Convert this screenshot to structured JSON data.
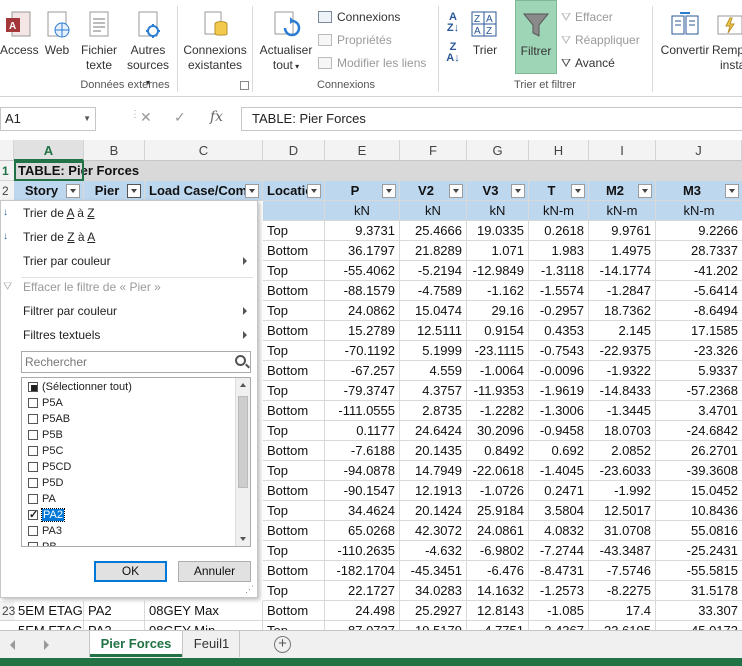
{
  "ribbon": {
    "buttons": {
      "access": "Access",
      "web": "Web",
      "text_file": "Fichier texte",
      "text_file_l1": "Fichier",
      "text_file_l2": "texte",
      "other_sources_l1": "Autres",
      "other_sources_l2": "sources",
      "existing_conn_l1": "Connexions",
      "existing_conn_l2": "existantes",
      "refresh_l1": "Actualiser",
      "refresh_l2": "tout",
      "connections": "Connexions",
      "properties": "Propriétés",
      "edit_links": "Modifier les liens",
      "sort": "Trier",
      "filter": "Filtrer",
      "clear": "Effacer",
      "reapply": "Réappliquer",
      "advanced": "Avancé",
      "convert": "Convertir",
      "remp_l1": "Remp",
      "remp_l2": "insta"
    },
    "groups": {
      "external_data": "Données externes",
      "connections": "Connexions",
      "sort_filter": "Trier et filtrer"
    }
  },
  "formula_bar": {
    "name_box": "A1",
    "fx": "fx",
    "content": "TABLE:  Pier Forces"
  },
  "grid": {
    "columns": [
      "A",
      "B",
      "C",
      "D",
      "E",
      "F",
      "G",
      "H",
      "I",
      "J"
    ],
    "row_numbers": {
      "r1": "1",
      "r2": "2",
      "r23": "23"
    },
    "title": "TABLE:  Pier Forces",
    "headers": [
      "Story",
      "Pier",
      "Load Case/Combo",
      "Location",
      "P",
      "V2",
      "V3",
      "T",
      "M2",
      "M3"
    ],
    "header_display": [
      "Story",
      "Pier",
      "Load Case/Coml",
      "Locatio",
      "P",
      "V2",
      "V3",
      "T",
      "M2",
      "M3"
    ],
    "units": [
      "kN",
      "kN",
      "kN",
      "kN-m",
      "kN-m",
      "kN-m"
    ],
    "rows": [
      [
        "Top",
        "9.3731",
        "25.4666",
        "19.0335",
        "0.2618",
        "9.9761",
        "9.2266"
      ],
      [
        "Bottom",
        "36.1797",
        "21.8289",
        "1.071",
        "1.983",
        "1.4975",
        "28.7337"
      ],
      [
        "Top",
        "-55.4062",
        "-5.2194",
        "-12.9849",
        "-1.3118",
        "-14.1774",
        "-41.202"
      ],
      [
        "Bottom",
        "-88.1579",
        "-4.7589",
        "-1.162",
        "-1.5574",
        "-1.2847",
        "-5.6414"
      ],
      [
        "Top",
        "24.0862",
        "15.0474",
        "29.16",
        "-0.2957",
        "18.7362",
        "-8.6494"
      ],
      [
        "Bottom",
        "15.2789",
        "12.5111",
        "0.9154",
        "0.4353",
        "2.145",
        "17.1585"
      ],
      [
        "Top",
        "-70.1192",
        "5.1999",
        "-23.1115",
        "-0.7543",
        "-22.9375",
        "-23.326"
      ],
      [
        "Bottom",
        "-67.257",
        "4.559",
        "-1.0064",
        "-0.0096",
        "-1.9322",
        "5.9337"
      ],
      [
        "Top",
        "-79.3747",
        "4.3757",
        "-11.9353",
        "-1.9619",
        "-14.8433",
        "-57.2368"
      ],
      [
        "Bottom",
        "-111.0555",
        "2.8735",
        "-1.2282",
        "-1.3006",
        "-1.3445",
        "3.4701"
      ],
      [
        "Top",
        "0.1177",
        "24.6424",
        "30.2096",
        "-0.9458",
        "18.0703",
        "-24.6842"
      ],
      [
        "Bottom",
        "-7.6188",
        "20.1435",
        "0.8492",
        "0.692",
        "2.0852",
        "26.2701"
      ],
      [
        "Top",
        "-94.0878",
        "14.7949",
        "-22.0618",
        "-1.4045",
        "-23.6033",
        "-39.3608"
      ],
      [
        "Bottom",
        "-90.1547",
        "12.1913",
        "-1.0726",
        "0.2471",
        "-1.992",
        "15.0452"
      ],
      [
        "Top",
        "34.4624",
        "20.1424",
        "25.9184",
        "3.5804",
        "12.5017",
        "10.8436"
      ],
      [
        "Bottom",
        "65.0268",
        "42.3072",
        "24.0861",
        "4.0832",
        "31.0708",
        "55.0816"
      ],
      [
        "Top",
        "-110.2635",
        "-4.632",
        "-6.9802",
        "-7.2744",
        "-43.3487",
        "-25.2431"
      ],
      [
        "Bottom",
        "-182.1704",
        "-45.3451",
        "-6.476",
        "-8.4731",
        "-7.5746",
        "-55.5815"
      ],
      [
        "Top",
        "22.1727",
        "34.0283",
        "14.1632",
        "-1.2573",
        "-8.2275",
        "31.5178"
      ]
    ],
    "row23": [
      "5EM ETAG",
      "PA2",
      "08GEY Max",
      "Bottom",
      "24.498",
      "25.2927",
      "12.8143",
      "-1.085",
      "17.4",
      "33.307"
    ],
    "row24_partial": [
      "5EM ETAG",
      "PA2",
      "08GEY Min",
      "Top",
      "-87.0737",
      "19.5179",
      "-4.7751",
      "-2.4367",
      "-23.6195",
      "-45.0173"
    ]
  },
  "filter_menu": {
    "sort_az_pre": "Trier de ",
    "sort_az_u1": "A",
    "sort_az_mid": " à ",
    "sort_az_u2": "Z",
    "sort_za_pre": "Trier de ",
    "sort_za_u1": "Z",
    "sort_za_mid": " à ",
    "sort_za_u2": "A",
    "sort_color": "Trier par couleur",
    "clear_filter": "Effacer le filtre de « Pier »",
    "filter_color": "Filtrer par couleur",
    "text_filters": "Filtres textuels",
    "search_placeholder": "Rechercher",
    "items": [
      "(Sélectionner tout)",
      "P5A",
      "P5AB",
      "P5B",
      "P5C",
      "P5CD",
      "P5D",
      "PA",
      "PA2",
      "PA3",
      "PB"
    ],
    "ok": "OK",
    "cancel": "Annuler"
  },
  "sheets": {
    "tabs": [
      "Pier Forces",
      "Feuil1"
    ],
    "active": "Pier Forces",
    "add": "+"
  },
  "colors": {
    "accent": "#217346",
    "header_fill": "#bdd7ee",
    "title_fill": "#d9d9d9",
    "selection": "#0078d7"
  }
}
